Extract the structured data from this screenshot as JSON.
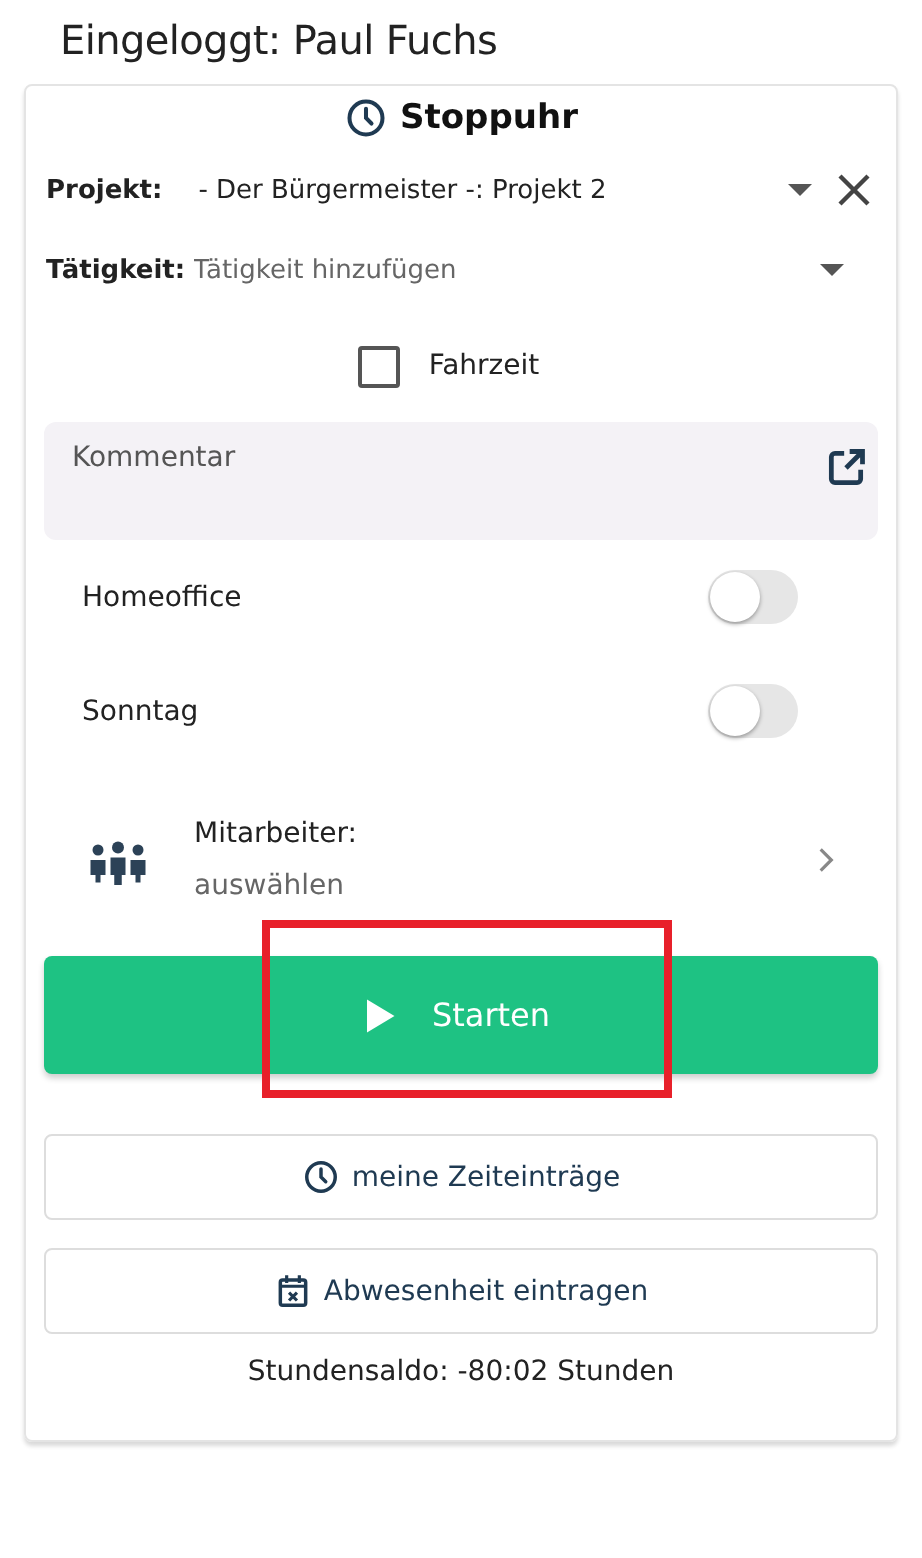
{
  "header": {
    "login_text": "Eingeloggt: Paul Fuchs"
  },
  "card": {
    "title": "Stoppuhr",
    "project": {
      "label": "Projekt:",
      "value": "- Der Bürgermeister -: Projekt 2"
    },
    "activity": {
      "label": "Tätigkeit:",
      "placeholder": "Tätigkeit hinzufügen"
    },
    "travel_time": {
      "label": "Fahrzeit",
      "checked": false
    },
    "comment": {
      "placeholder": "Kommentar"
    },
    "toggles": [
      {
        "label": "Homeoffice",
        "on": false
      },
      {
        "label": "Sonntag",
        "on": false
      }
    ],
    "employees": {
      "label": "Mitarbeiter:",
      "value": "auswählen"
    },
    "start_button": {
      "label": "Starten",
      "highlighted": true
    },
    "buttons": [
      {
        "kind": "clock",
        "label": "meine Zeiteinträge"
      },
      {
        "kind": "calendar",
        "label": "Abwesenheit eintragen"
      }
    ],
    "balance": "Stundensaldo: -80:02 Stunden"
  }
}
